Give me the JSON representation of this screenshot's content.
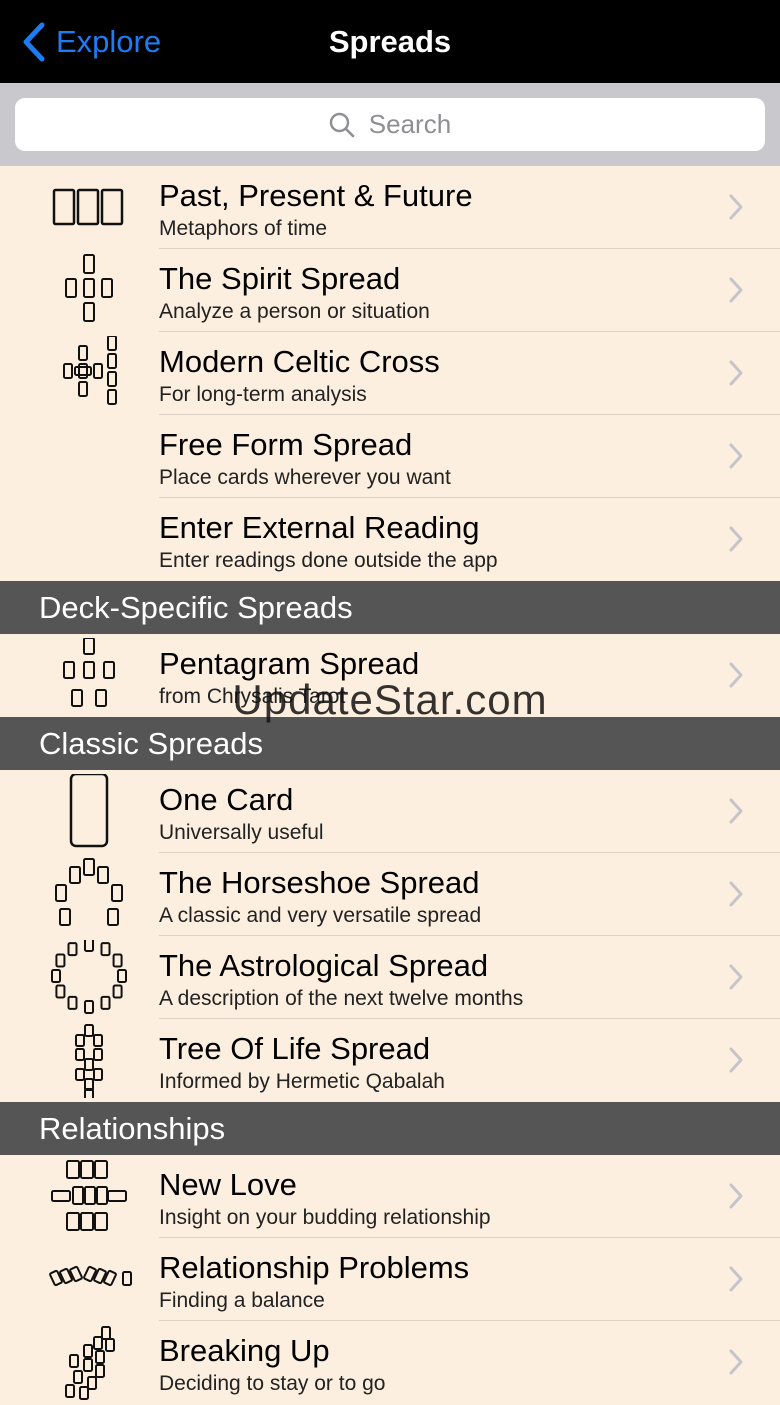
{
  "nav": {
    "back_label": "Explore",
    "title": "Spreads"
  },
  "search": {
    "placeholder": "Search"
  },
  "sections": [
    {
      "header": "",
      "rows": [
        {
          "title": "Past, Present & Future",
          "subtitle": "Metaphors of time",
          "icon": "three-card-icon"
        },
        {
          "title": "The Spirit Spread",
          "subtitle": "Analyze a person or situation",
          "icon": "spirit-spread-icon"
        },
        {
          "title": "Modern Celtic Cross",
          "subtitle": "For long-term analysis",
          "icon": "celtic-cross-icon"
        },
        {
          "title": "Free Form Spread",
          "subtitle": "Place cards wherever you want",
          "icon": ""
        },
        {
          "title": "Enter External Reading",
          "subtitle": "Enter readings done outside the app",
          "icon": ""
        }
      ]
    },
    {
      "header": "Deck-Specific Spreads",
      "rows": [
        {
          "title": "Pentagram Spread",
          "subtitle": "from Chrysalis Tarot",
          "icon": "pentagram-icon"
        }
      ]
    },
    {
      "header": "Classic Spreads",
      "rows": [
        {
          "title": "One Card",
          "subtitle": "Universally useful",
          "icon": "one-card-icon"
        },
        {
          "title": "The Horseshoe Spread",
          "subtitle": "A classic and very versatile spread",
          "icon": "horseshoe-icon"
        },
        {
          "title": "The Astrological Spread",
          "subtitle": "A description of the next twelve months",
          "icon": "astrological-icon"
        },
        {
          "title": "Tree Of Life Spread",
          "subtitle": "Informed by Hermetic Qabalah",
          "icon": "tree-of-life-icon"
        }
      ]
    },
    {
      "header": "Relationships",
      "rows": [
        {
          "title": "New Love",
          "subtitle": "Insight on your budding relationship",
          "icon": "new-love-icon"
        },
        {
          "title": "Relationship Problems",
          "subtitle": "Finding a balance",
          "icon": "relationship-problems-icon"
        },
        {
          "title": "Breaking Up",
          "subtitle": "Deciding to stay or to go",
          "icon": "breaking-up-icon"
        }
      ]
    }
  ],
  "watermark": "UpdateStar.com",
  "colors": {
    "accent": "#1e7cf2",
    "list_bg": "#fdefdf",
    "header_bg": "#555555",
    "nav_bg": "#000000"
  }
}
